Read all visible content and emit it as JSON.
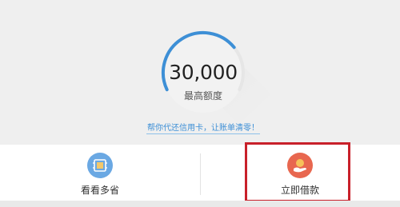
{
  "credit": {
    "amount": "30,000",
    "amount_label": "最高额度",
    "gauge_fill": 0.72,
    "promo_link": "帮你代还信用卡，让账单清零！"
  },
  "actions": [
    {
      "label": "看看多省",
      "icon": "document-icon"
    },
    {
      "label": "立即借款",
      "icon": "hand-coin-icon"
    }
  ],
  "colors": {
    "gauge_blue": "#3d8fd6",
    "gauge_track": "#e6e6e6",
    "icon_blue": "#6aa8e3",
    "icon_red": "#e8674f",
    "highlight_red": "#c8202a"
  }
}
